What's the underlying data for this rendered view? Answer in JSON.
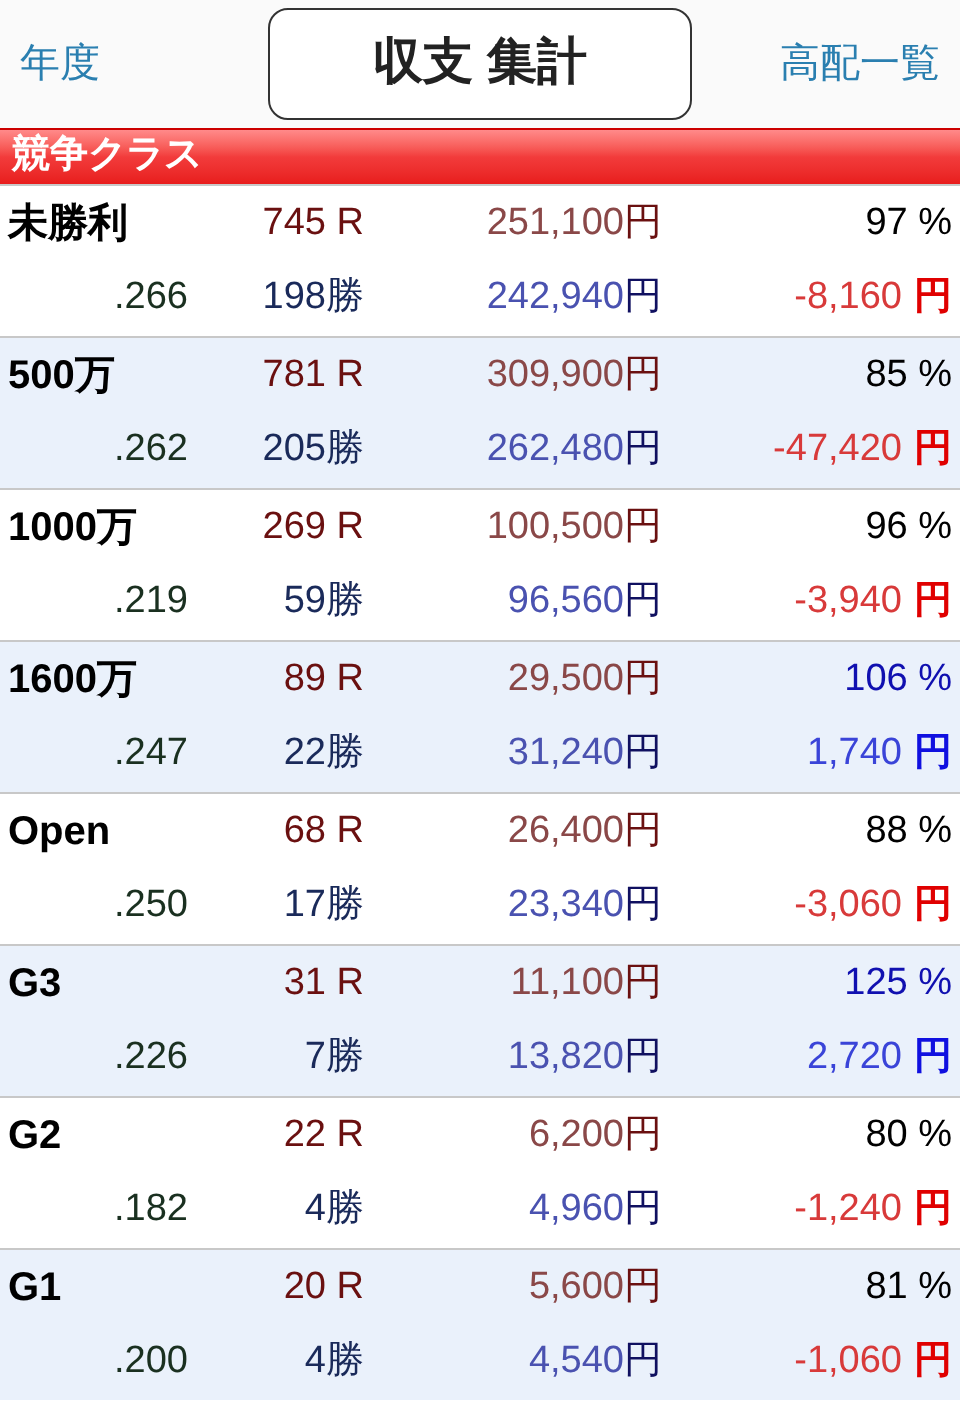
{
  "header": {
    "left_link": "年度",
    "title": "収支 集計",
    "right_link": "高配一覧"
  },
  "section": {
    "title": "競争クラス"
  },
  "rows": [
    {
      "name": "未勝利",
      "races": "745 R",
      "rate": ".266",
      "wins": "198勝",
      "stake": "251,100",
      "stake_unit": "円",
      "payout": "242,940",
      "payout_unit": "円",
      "return": "97 %",
      "balance": "-8,160",
      "balance_unit": "円",
      "profit": false
    },
    {
      "name": "500万",
      "races": "781 R",
      "rate": ".262",
      "wins": "205勝",
      "stake": "309,900",
      "stake_unit": "円",
      "payout": "262,480",
      "payout_unit": "円",
      "return": "85 %",
      "balance": "-47,420",
      "balance_unit": "円",
      "profit": false
    },
    {
      "name": "1000万",
      "races": "269 R",
      "rate": ".219",
      "wins": "59勝",
      "stake": "100,500",
      "stake_unit": "円",
      "payout": "96,560",
      "payout_unit": "円",
      "return": "96 %",
      "balance": "-3,940",
      "balance_unit": "円",
      "profit": false
    },
    {
      "name": "1600万",
      "races": "89 R",
      "rate": ".247",
      "wins": "22勝",
      "stake": "29,500",
      "stake_unit": "円",
      "payout": "31,240",
      "payout_unit": "円",
      "return": "106 %",
      "balance": "1,740",
      "balance_unit": "円",
      "profit": true
    },
    {
      "name": "Open",
      "races": "68 R",
      "rate": ".250",
      "wins": "17勝",
      "stake": "26,400",
      "stake_unit": "円",
      "payout": "23,340",
      "payout_unit": "円",
      "return": "88 %",
      "balance": "-3,060",
      "balance_unit": "円",
      "profit": false
    },
    {
      "name": "G3",
      "races": "31 R",
      "rate": ".226",
      "wins": "7勝",
      "stake": "11,100",
      "stake_unit": "円",
      "payout": "13,820",
      "payout_unit": "円",
      "return": "125 %",
      "balance": "2,720",
      "balance_unit": "円",
      "profit": true
    },
    {
      "name": "G2",
      "races": "22 R",
      "rate": ".182",
      "wins": "4勝",
      "stake": "6,200",
      "stake_unit": "円",
      "payout": "4,960",
      "payout_unit": "円",
      "return": "80 %",
      "balance": "-1,240",
      "balance_unit": "円",
      "profit": false
    },
    {
      "name": "G1",
      "races": "20 R",
      "rate": ".200",
      "wins": "4勝",
      "stake": "5,600",
      "stake_unit": "円",
      "payout": "4,540",
      "payout_unit": "円",
      "return": "81 %",
      "balance": "-1,060",
      "balance_unit": "円",
      "profit": false
    }
  ]
}
